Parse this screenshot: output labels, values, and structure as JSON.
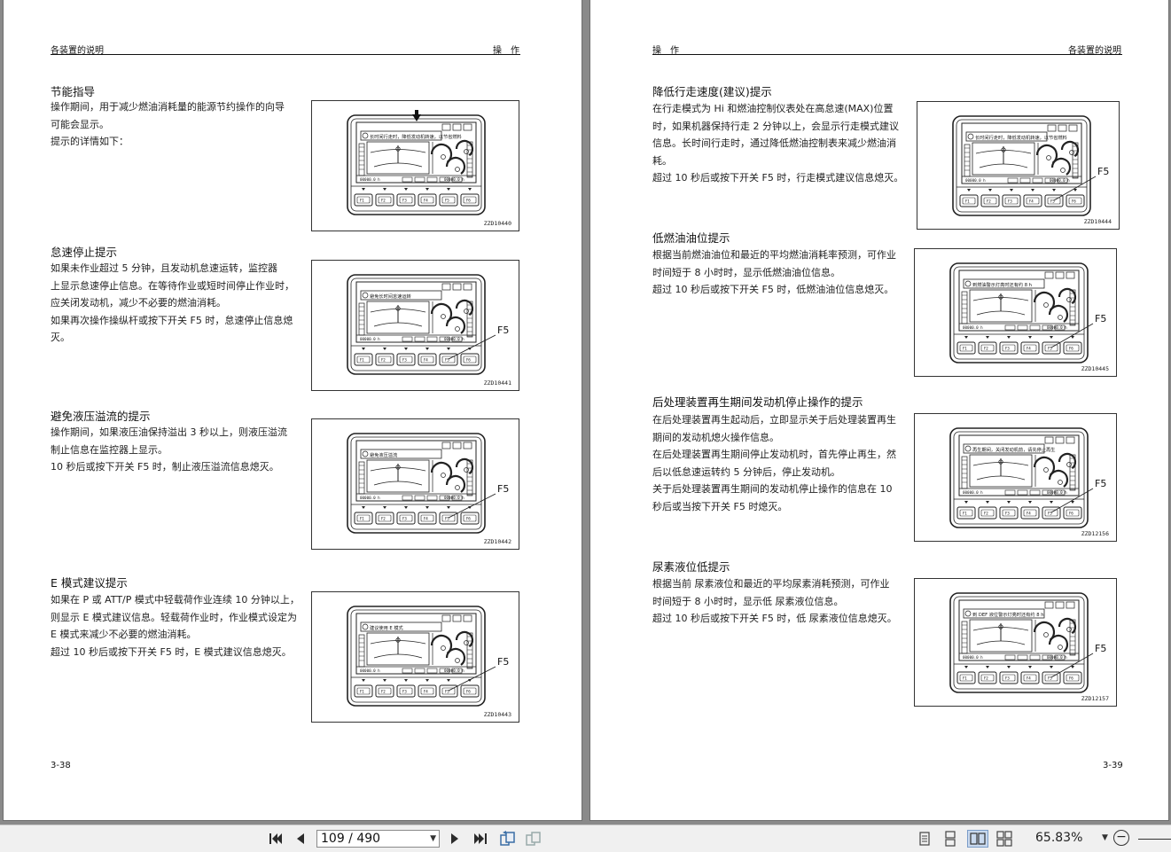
{
  "left_page": {
    "header_left": "各装置的说明",
    "header_right": "操　作",
    "folio": "3-38",
    "sections": [
      {
        "title": "节能指导",
        "lines": [
          "操作期间，用于减少燃油消耗量的能源节约操作的向导",
          "可能会显示。",
          "提示的详情如下："
        ],
        "figure_code": "ZZD10440",
        "banner": "长时间行走时，降低发动机转速，以节省燃料",
        "f5": ""
      },
      {
        "title": "怠速停止提示",
        "lines": [
          "如果未作业超过 5 分钟，且发动机怠速运转，监控器",
          "上显示怠速停止信息。在等待作业或短时间停止作业时，",
          "应关闭发动机，减少不必要的燃油消耗。",
          "如果再次操作操纵杆或按下开关 F5 时，怠速停止信息熄",
          "灭。"
        ],
        "figure_code": "ZZD10441",
        "banner": "避免长时间怠速运转",
        "f5": "F5"
      },
      {
        "title": "避免液压溢流的提示",
        "lines": [
          "操作期间，如果液压油保持溢出 3 秒以上，则液压溢流",
          "制止信息在监控器上显示。",
          "10 秒后或按下开关 F5 时，制止液压溢流信息熄灭。"
        ],
        "figure_code": "ZZD10442",
        "banner": "避免液压溢流",
        "f5": "F5"
      },
      {
        "title": "E  模式建议提示",
        "lines": [
          "如果在 P 或 ATT/P 模式中轻载荷作业连续 10 分钟以上，",
          "则显示 E 模式建议信息。轻载荷作业时，作业模式设定为",
          "E 模式来减少不必要的燃油消耗。",
          "超过 10 秒后或按下开关 F5 时，E 模式建议信息熄灭。"
        ],
        "figure_code": "ZZD10443",
        "banner": "建议使用 E 模式",
        "f5": "F5"
      }
    ]
  },
  "right_page": {
    "header_left": "操　作",
    "header_right": "各装置的说明",
    "folio": "3-39",
    "sections": [
      {
        "title": "降低行走速度(建议)提示",
        "lines": [
          "在行走模式为  Hi  和燃油控制仪表处在高怠速(MAX)位置",
          "时，如果机器保持行走 2 分钟以上，会显示行走模式建议",
          "信息。长时间行走时，通过降低燃油控制表来减少燃油消",
          "耗。",
          "超过 10 秒后或按下开关 F5 时，行走模式建议信息熄灭。"
        ],
        "figure_code": "ZZD10444",
        "banner": "长时间行走时，降低发动机转速，以节省燃料",
        "f5": "F5"
      },
      {
        "title": "低燃油油位提示",
        "lines": [
          "根据当前燃油油位和最近的平均燃油消耗率预测，可作业",
          "时间短于 8 小时时，显示低燃油油位信息。",
          "超过 10 秒后或按下开关 F5 时，低燃油油位信息熄灭。"
        ],
        "figure_code": "ZZD10445",
        "banner": "到燃油警示灯亮时还有约 8 h",
        "f5": "F5"
      },
      {
        "title": "后处理装置再生期间发动机停止操作的提示",
        "lines": [
          "在后处理装置再生起动后，立即显示关于后处理装置再生",
          "期间的发动机熄火操作信息。",
          "在后处理装置再生期间停止发动机时，首先停止再生，然",
          "后以低怠速运转约 5 分钟后，停止发动机。",
          "关于后处理装置再生期间的发动机停止操作的信息在  10",
          "秒后或当按下开关 F5 时熄灭。"
        ],
        "figure_code": "ZZD12156",
        "banner": "再生期间，关闭发动机前，请先停止再生",
        "f5": "F5"
      },
      {
        "title": "尿素液位低提示",
        "lines": [
          "根据当前  尿素液位和最近的平均尿素消耗预测，可作业",
          "时间短于 8 小时时，显示低  尿素液位信息。",
          "超过 10 秒后或按下开关 F5 时，低  尿素液位信息熄灭。"
        ],
        "figure_code": "ZZD12157",
        "banner": "到 DEF 液位警示灯亮时还有约 8 h",
        "f5": "F5"
      }
    ]
  },
  "monitor": {
    "fn_keys": [
      "F1",
      "F2",
      "F3",
      "F4",
      "F5",
      "F6"
    ],
    "hour_meter": "00000.0 h",
    "odo": "00000.0 h"
  },
  "toolbar": {
    "current_page": "109",
    "total_pages": "490",
    "page_label": "109 / 490",
    "zoom": "65.83%",
    "icons": [
      "first-page-icon",
      "prev-page-icon",
      "next-page-icon",
      "last-page-icon",
      "previous-view-icon",
      "next-view-icon",
      "single-page-icon",
      "continuous-icon",
      "facing-icon",
      "continuous-facing-icon"
    ]
  }
}
